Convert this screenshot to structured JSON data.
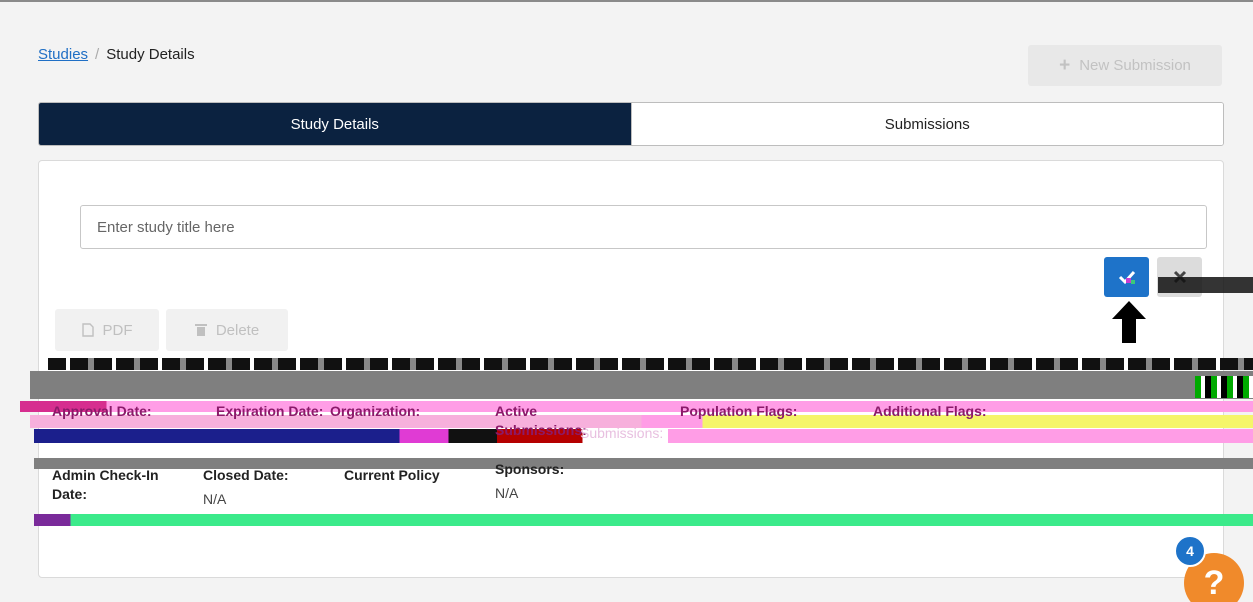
{
  "breadcrumb": {
    "parent": "Studies",
    "separator": "/",
    "current": "Study Details"
  },
  "header": {
    "new_submission_label": "New Submission"
  },
  "tabs": [
    {
      "label": "Study Details"
    },
    {
      "label": "Submissions"
    }
  ],
  "study_title_input": {
    "placeholder": "Enter study title here",
    "value": ""
  },
  "actions": {
    "pdf_label": "PDF",
    "delete_label": "Delete"
  },
  "fields_row1": [
    {
      "label": "Approval Date:"
    },
    {
      "label": "Expiration Date:"
    },
    {
      "label": "Organization:"
    },
    {
      "label": "Active Submissions:",
      "value": "Submissions:"
    },
    {
      "label": "Population Flags:"
    },
    {
      "label": "Additional Flags:"
    }
  ],
  "fields_row2": [
    {
      "label": "Admin Check-In Date:"
    },
    {
      "label": "Closed Date:",
      "value": "N/A"
    },
    {
      "label": "Current Policy"
    },
    {
      "label": "Sponsors:",
      "value": "N/A"
    }
  ],
  "help": {
    "badge_count": "4",
    "icon": "?"
  },
  "colors": {
    "tab_active_bg": "#0b2240",
    "primary": "#1e73c9",
    "help": "#f08a2b"
  }
}
